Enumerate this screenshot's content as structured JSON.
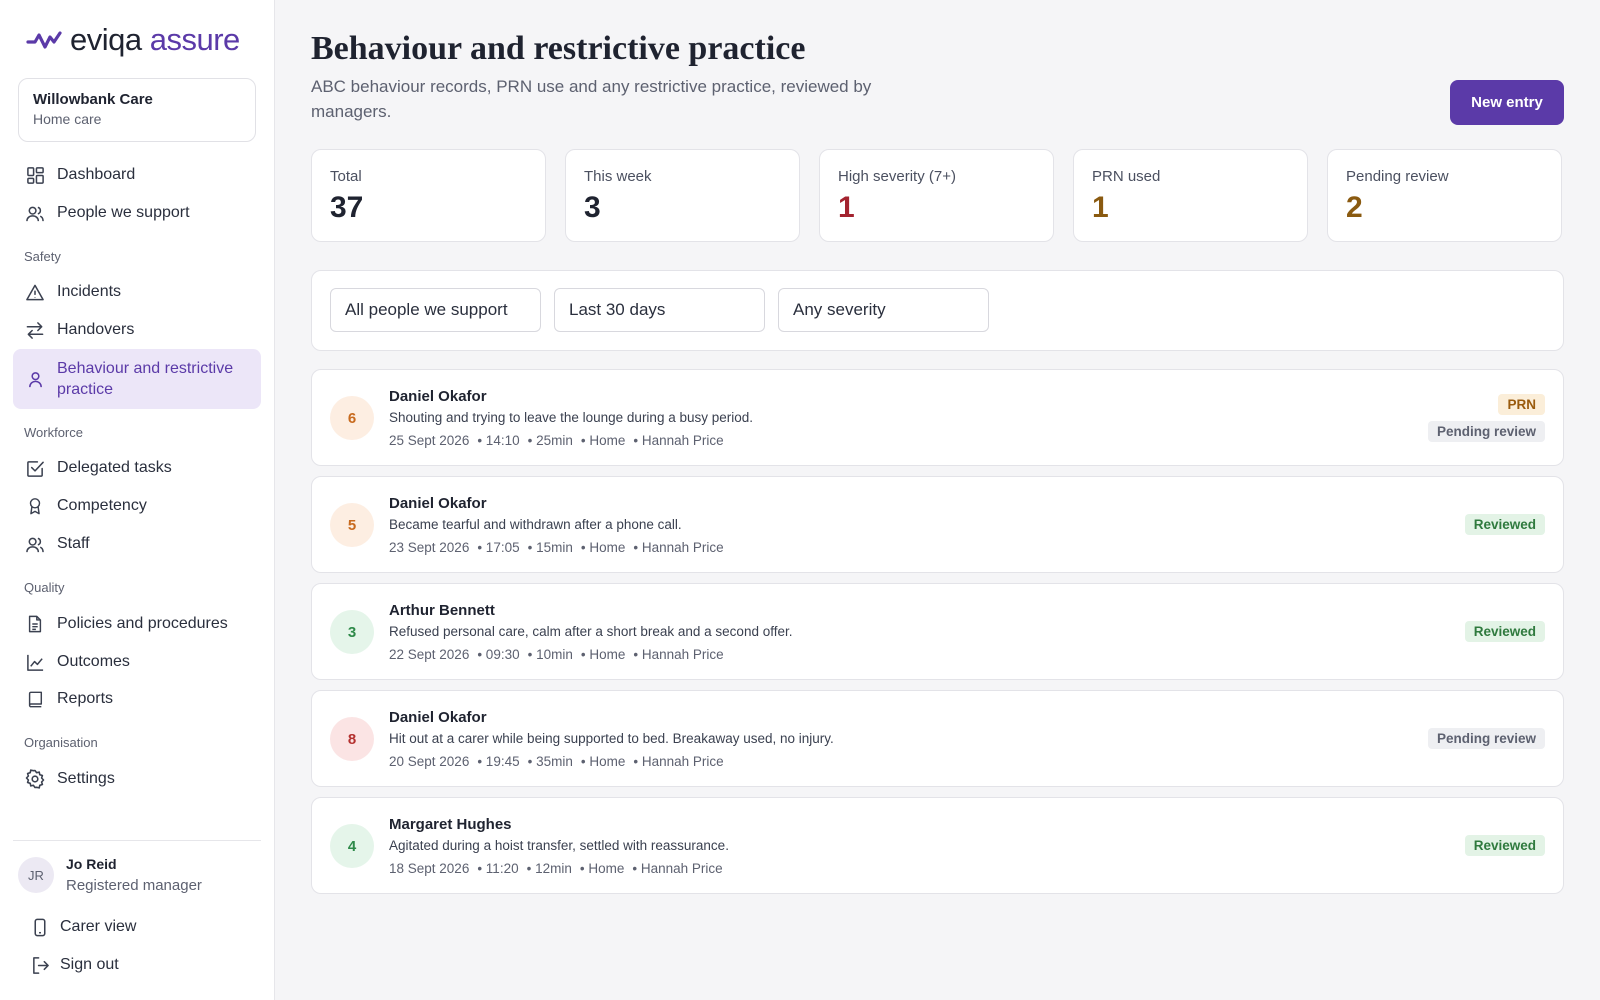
{
  "brand": {
    "logo_text_main": "eviqa",
    "logo_text_accent": "assure"
  },
  "org": {
    "name": "Willowbank Care",
    "type": "Home care"
  },
  "nav": {
    "dashboard": "Dashboard",
    "people": "People we support",
    "safety_label": "Safety",
    "incidents": "Incidents",
    "handovers": "Handovers",
    "behaviour_line1": "Behaviour and restrictive",
    "behaviour_line2": "practice",
    "workforce_label": "Workforce",
    "delegated": "Delegated tasks",
    "competency": "Competency",
    "staff": "Staff",
    "quality_label": "Quality",
    "policies": "Policies and procedures",
    "outcomes": "Outcomes",
    "reports": "Reports",
    "organisation_label": "Organisation",
    "settings": "Settings",
    "carer_view": "Carer view",
    "sign_out": "Sign out"
  },
  "user": {
    "initials": "JR",
    "name": "Jo Reid",
    "role": "Registered manager"
  },
  "page": {
    "title": "Behaviour and restrictive practice",
    "subtitle": "ABC behaviour records, PRN use and any restrictive practice, reviewed by managers.",
    "new_button": "New entry"
  },
  "stats": [
    {
      "label": "Total",
      "value": "37",
      "color": "#1f2330"
    },
    {
      "label": "This week",
      "value": "3",
      "color": "#1f2330"
    },
    {
      "label": "High severity (7+)",
      "value": "1",
      "color": "#a3232f"
    },
    {
      "label": "PRN used",
      "value": "1",
      "color": "#8a5a10"
    },
    {
      "label": "Pending review",
      "value": "2",
      "color": "#8a5a10"
    }
  ],
  "filters": {
    "person": "All people we support",
    "period": "Last 30 days",
    "severity": "Any severity"
  },
  "entries": [
    {
      "severity": "6",
      "name": "Daniel Okafor",
      "desc": "Shouting and trying to leave the lounge during a busy period.",
      "date": "25 Sept 2026",
      "time": "• 14:10",
      "duration": "• 25min",
      "place": "• Home",
      "staff": "• Hannah Price",
      "prn": "PRN",
      "status": "Pending review"
    },
    {
      "severity": "5",
      "name": "Daniel Okafor",
      "desc": "Became tearful and withdrawn after a phone call.",
      "date": "23 Sept 2026",
      "time": "• 17:05",
      "duration": "• 15min",
      "place": "• Home",
      "staff": "• Hannah Price",
      "status": "Reviewed"
    },
    {
      "severity": "3",
      "name": "Arthur Bennett",
      "desc": "Refused personal care, calm after a short break and a second offer.",
      "date": "22 Sept 2026",
      "time": "• 09:30",
      "duration": "• 10min",
      "place": "• Home",
      "staff": "• Hannah Price",
      "status": "Reviewed"
    },
    {
      "severity": "8",
      "name": "Daniel Okafor",
      "desc": "Hit out at a carer while being supported to bed. Breakaway used, no injury.",
      "date": "20 Sept 2026",
      "time": "• 19:45",
      "duration": "• 35min",
      "place": "• Home",
      "staff": "• Hannah Price",
      "status": "Pending review"
    },
    {
      "severity": "4",
      "name": "Margaret Hughes",
      "desc": "Agitated during a hoist transfer, settled with reassurance.",
      "date": "18 Sept 2026",
      "time": "• 11:20",
      "duration": "• 12min",
      "place": "• Home",
      "staff": "• Hannah Price",
      "status": "Reviewed"
    }
  ],
  "colors": {
    "brand": "#5b3aa8",
    "sev_amber_bg": "#fdeee2",
    "sev_amber_fg": "#c86a1e",
    "sev_green_bg": "#e5f5ea",
    "sev_green_fg": "#2f8a4a",
    "sev_red_bg": "#fbe4e4",
    "sev_red_fg": "#b4312f"
  }
}
